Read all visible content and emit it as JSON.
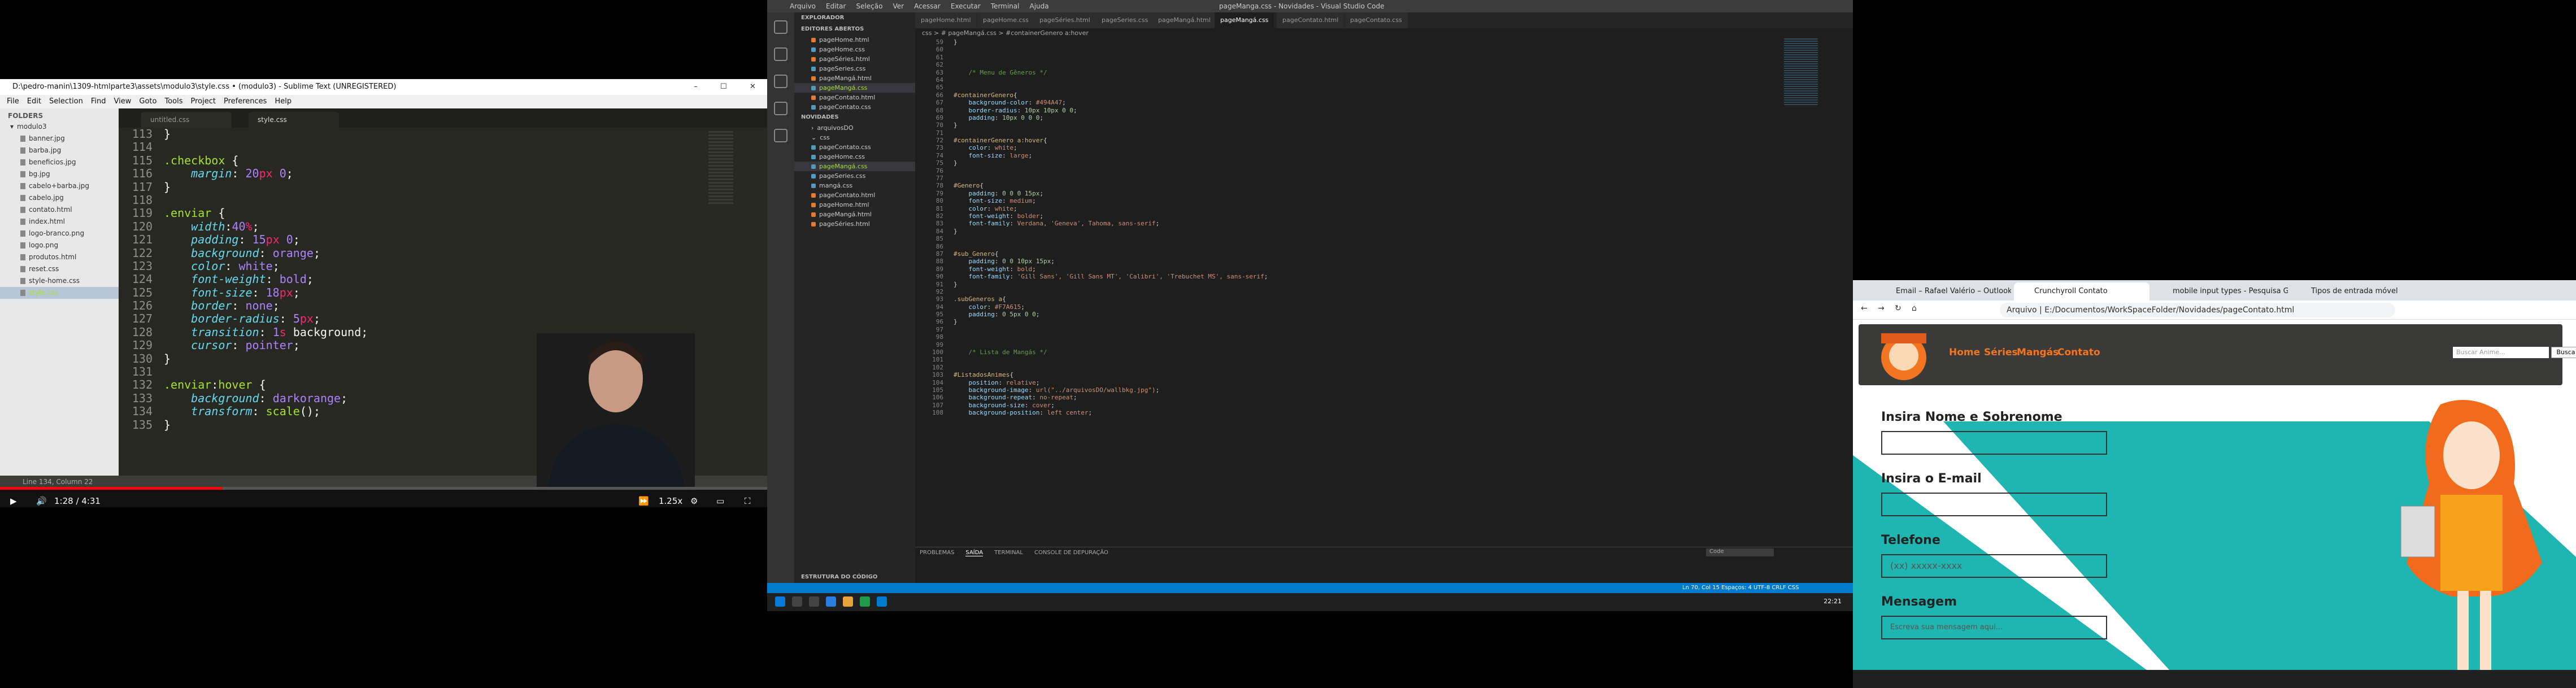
{
  "sublime": {
    "title": "D:\\pedro-manin\\1309-htmlparte3\\assets\\modulo3\\style.css • (modulo3) - Sublime Text (UNREGISTERED)",
    "menu": [
      "File",
      "Edit",
      "Selection",
      "Find",
      "View",
      "Goto",
      "Tools",
      "Project",
      "Preferences",
      "Help"
    ],
    "folders_header": "FOLDERS",
    "root_folder": "modulo3",
    "files": [
      "banner.jpg",
      "barba.jpg",
      "beneficios.jpg",
      "bg.jpg",
      "cabelo+barba.jpg",
      "cabelo.jpg",
      "contato.html",
      "index.html",
      "logo-branco.png",
      "logo.png",
      "produtos.html",
      "reset.css",
      "style-home.css",
      "style.css"
    ],
    "tabs": [
      "untitled.css",
      "style.css"
    ],
    "line_numbers": [
      "113",
      "114",
      "115",
      "116",
      "117",
      "118",
      "119",
      "120",
      "121",
      "122",
      "123",
      "124",
      "125",
      "126",
      "127",
      "128",
      "129",
      "130",
      "131",
      "132",
      "133",
      "134",
      "135"
    ],
    "status": "Line 134, Column 22"
  },
  "video": {
    "time": "1:28 / 4:31",
    "speed": "1.25x",
    "progress_fraction": 0.29
  },
  "vscode": {
    "title": "pageManga.css - Novidades - Visual Studio Code",
    "menu": [
      "Arquivo",
      "Editar",
      "Seleção",
      "Ver",
      "Acessar",
      "Executar",
      "Terminal",
      "Ajuda"
    ],
    "explorer_header": "EXPLORADOR",
    "open_editors_header": "EDITORES ABERTOS",
    "open_editors": [
      "pageHome.html",
      "pageHome.css",
      "pageSéries.html",
      "pageSeries.css",
      "pageMangá.html",
      "pageMangá.css",
      "pageContato.html",
      "pageContato.css"
    ],
    "project_header": "NOVIDADES",
    "project_files": [
      "arquivosDO",
      "css",
      "pageContato.css",
      "pageHome.css",
      "pageMangá.css",
      "pageSeries.css",
      "mangá.css",
      "pageContato.html",
      "pageHome.html",
      "pageMangá.html",
      "pageSéries.html"
    ],
    "outline_header": "ESTRUTURA DO CÓDIGO",
    "tabs": [
      "pageHome.html",
      "pageHome.css",
      "pageSéries.html",
      "pageSeries.css",
      "pageMangá.html",
      "pageMangá.css",
      "pageContato.html",
      "pageContato.css"
    ],
    "breadcrumb": "css > # pageMangá.css > #containerGenero a:hover",
    "line_numbers": [
      "59",
      "60",
      "61",
      "62",
      "63",
      "64",
      "65",
      "66",
      "67",
      "68",
      "69",
      "70",
      "71",
      "72",
      "73",
      "74",
      "75",
      "76",
      "77",
      "78",
      "79",
      "80",
      "81",
      "82",
      "83",
      "84",
      "85",
      "86",
      "87",
      "88",
      "89",
      "90",
      "91",
      "92",
      "93",
      "94",
      "95",
      "96",
      "97",
      "98",
      "99",
      "100",
      "101",
      "102",
      "103",
      "104",
      "105",
      "106",
      "107",
      "108"
    ],
    "panel_tabs": [
      "PROBLEMAS",
      "SAÍDA",
      "TERMINAL",
      "CONSOLE DE DEPURAÇÃO"
    ],
    "panel_select": "Code",
    "status_right": "Ln 70, Col 15   Espaços: 4   UTF-8   CRLF   CSS",
    "clock": "22:21"
  },
  "browser": {
    "tabs": [
      "Email – Rafael Valério – Outlook",
      "Crunchyroll Contato",
      "mobile input types - Pesquisa G...",
      "Tipos de entrada móvel"
    ],
    "address": "Arquivo  |  E:/Documentos/WorkSpaceFolder/Novidades/pageContato.html",
    "nav_links": [
      "Home",
      "Séries",
      "Mangás",
      "Contato"
    ],
    "search_placeholder": "Buscar Anime...",
    "search_button": "Busca",
    "form": {
      "name_label": "Insira Nome e Sobrenome",
      "email_label": "Insira o E-mail",
      "phone_label": "Telefone",
      "phone_placeholder": "(xx) xxxxx-xxxx",
      "message_label": "Mensagem",
      "message_placeholder": "Escreva sua mensagem aqui..."
    }
  },
  "colors": {
    "sublime_bg": "#272822",
    "vscode_bg": "#1e1e1e",
    "vscode_status": "#007acc",
    "crunchy_orange": "#f47521",
    "teal": "#1fb5b0"
  }
}
